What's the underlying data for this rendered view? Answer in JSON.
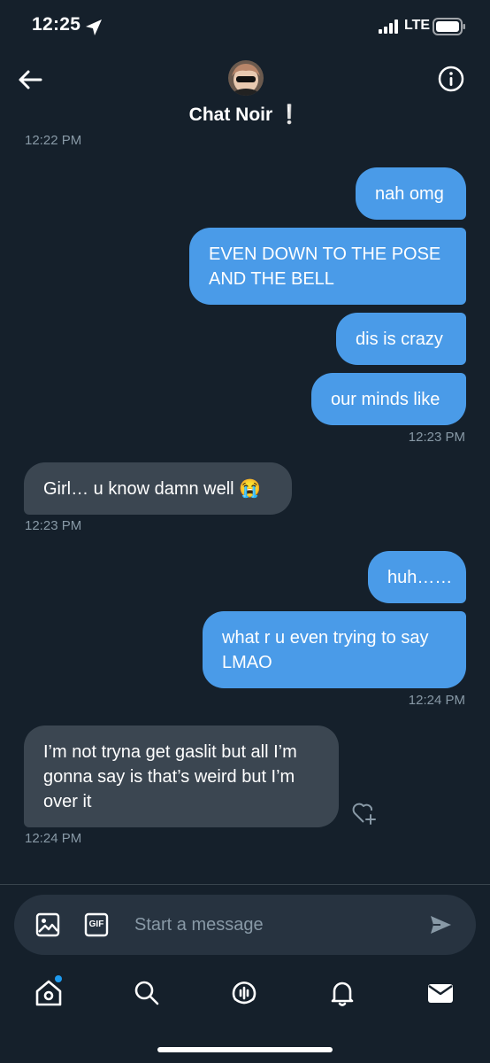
{
  "status_bar": {
    "time": "12:25",
    "network": "LTE"
  },
  "header": {
    "title": "Chat Noir",
    "badge": "❕",
    "timestamp": "12:22 PM"
  },
  "messages": [
    {
      "dir": "out",
      "text": "nah omg"
    },
    {
      "dir": "out",
      "text": "EVEN DOWN TO THE POSE AND THE BELL"
    },
    {
      "dir": "out",
      "text": "dis is crazy"
    },
    {
      "dir": "out",
      "text": "our minds like"
    },
    {
      "dir": "ts",
      "text": "12:23 PM"
    },
    {
      "dir": "in",
      "text": "Girl… u know damn well 😭"
    },
    {
      "dir": "ts",
      "text": "12:23 PM"
    },
    {
      "dir": "out",
      "text": "huh……"
    },
    {
      "dir": "out",
      "text": "what r u even trying to say LMAO"
    },
    {
      "dir": "ts",
      "text": "12:24 PM"
    },
    {
      "dir": "in",
      "text": "I’m not tryna get gaslit but all I’m gonna say is that’s weird but I’m over it"
    },
    {
      "dir": "ts",
      "text": "12:24 PM"
    }
  ],
  "composer": {
    "placeholder": "Start a message",
    "gif_label": "GIF"
  },
  "icons": {
    "back": "back-arrow-icon",
    "info": "info-icon",
    "image": "image-icon",
    "gif": "gif-icon",
    "send": "send-icon",
    "home": "home-icon",
    "search": "search-icon",
    "spaces": "spaces-icon",
    "notifications": "bell-icon",
    "messages": "mail-icon"
  },
  "colors": {
    "background": "#15202b",
    "outgoing": "#4a9be8",
    "incoming": "#3b4651",
    "accent": "#1d9bf0"
  }
}
